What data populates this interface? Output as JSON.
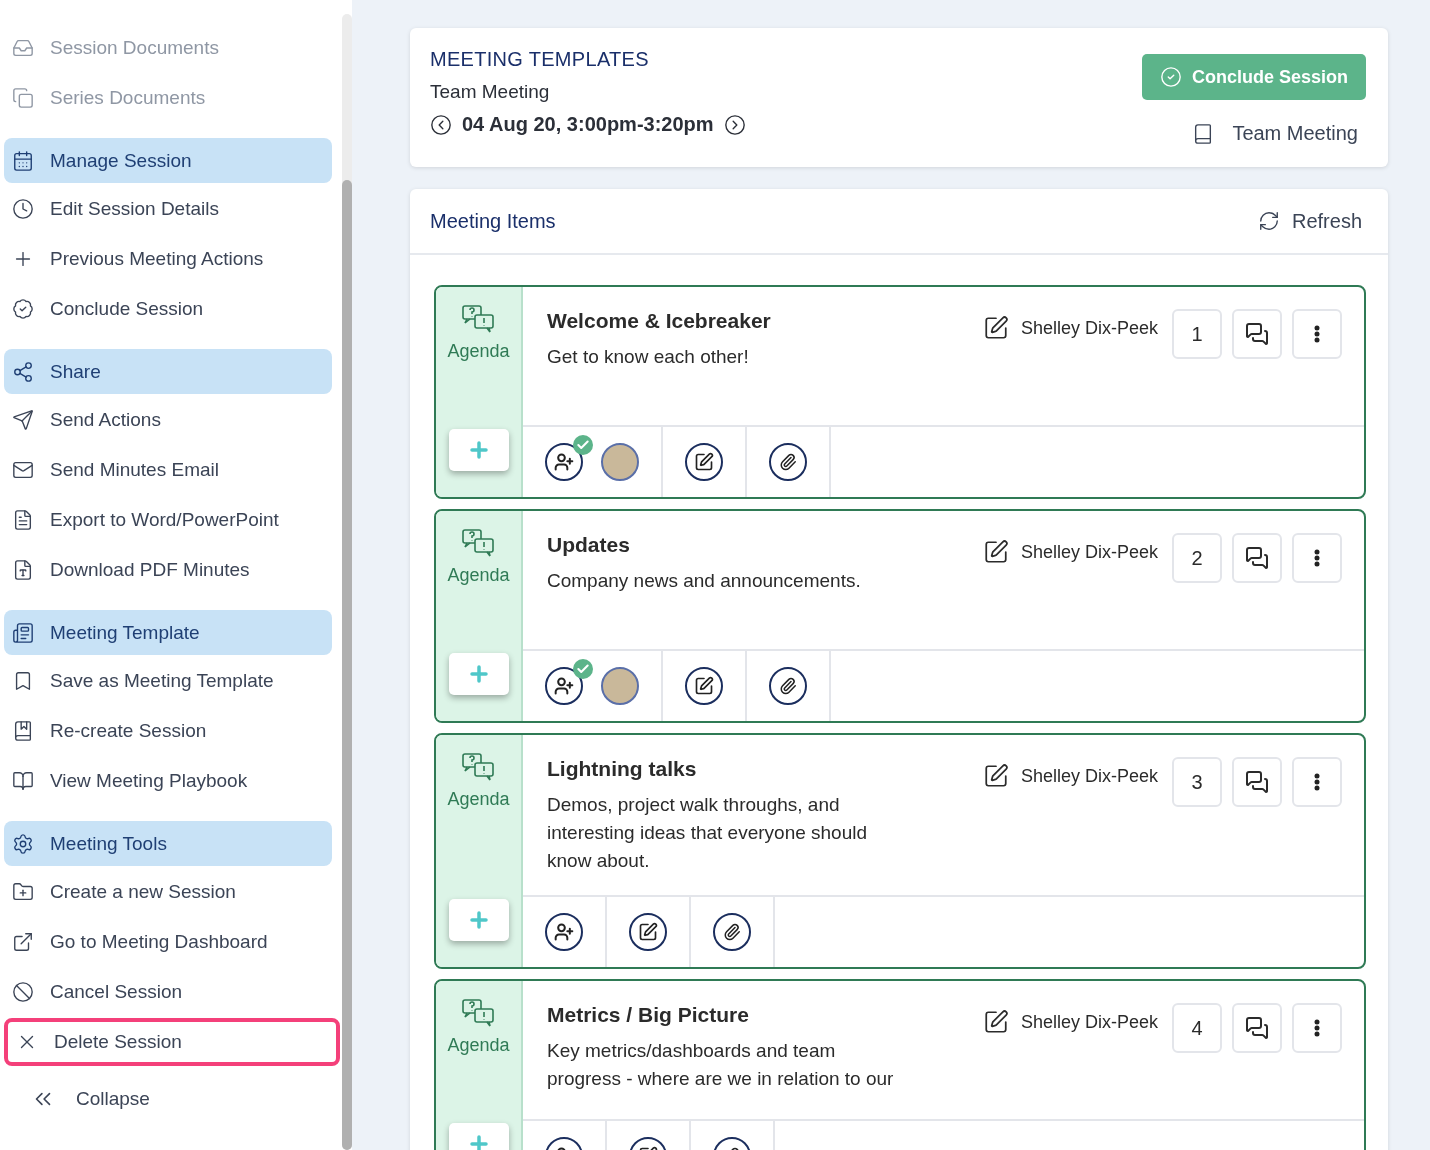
{
  "sidebar": {
    "items": [
      {
        "kind": "item",
        "label": "Session Documents",
        "disabled": true,
        "highlighted": false
      },
      {
        "kind": "item",
        "label": "Series Documents",
        "disabled": true,
        "highlighted": false
      },
      {
        "kind": "section",
        "label": "Manage Session"
      },
      {
        "kind": "item",
        "label": "Edit Session Details",
        "disabled": false,
        "highlighted": false
      },
      {
        "kind": "item",
        "label": "Previous Meeting Actions",
        "disabled": false,
        "highlighted": false
      },
      {
        "kind": "item",
        "label": "Conclude Session",
        "disabled": false,
        "highlighted": false
      },
      {
        "kind": "section",
        "label": "Share"
      },
      {
        "kind": "item",
        "label": "Send Actions",
        "disabled": false,
        "highlighted": false
      },
      {
        "kind": "item",
        "label": "Send Minutes Email",
        "disabled": false,
        "highlighted": false
      },
      {
        "kind": "item",
        "label": "Export to Word/PowerPoint",
        "disabled": false,
        "highlighted": false
      },
      {
        "kind": "item",
        "label": "Download PDF Minutes",
        "disabled": false,
        "highlighted": false
      },
      {
        "kind": "section",
        "label": "Meeting Template"
      },
      {
        "kind": "item",
        "label": "Save as Meeting Template",
        "disabled": false,
        "highlighted": false
      },
      {
        "kind": "item",
        "label": "Re-create Session",
        "disabled": false,
        "highlighted": false
      },
      {
        "kind": "item",
        "label": "View Meeting Playbook",
        "disabled": false,
        "highlighted": false
      },
      {
        "kind": "section",
        "label": "Meeting Tools"
      },
      {
        "kind": "item",
        "label": "Create a new Session",
        "disabled": false,
        "highlighted": false
      },
      {
        "kind": "item",
        "label": "Go to Meeting Dashboard",
        "disabled": false,
        "highlighted": false
      },
      {
        "kind": "item",
        "label": "Cancel Session",
        "disabled": false,
        "highlighted": false
      },
      {
        "kind": "item",
        "label": "Delete Session",
        "disabled": false,
        "highlighted": true
      }
    ],
    "collapse": "Collapse"
  },
  "header": {
    "heading": "MEETING TEMPLATES",
    "meeting_name": "Team Meeting",
    "date_time": "04 Aug 20, 3:00pm-3:20pm",
    "conclude_button": "Conclude Session",
    "template_link": "Team Meeting"
  },
  "meeting_items": {
    "title": "Meeting Items",
    "refresh": "Refresh",
    "items": [
      {
        "type_label": "Agenda",
        "title": "Welcome & Icebreaker",
        "description": "Get to know each other!",
        "owner": "Shelley Dix-Peek",
        "number": "1",
        "attendee_confirmed": true,
        "guest_avatar": true
      },
      {
        "type_label": "Agenda",
        "title": "Updates",
        "description": "Company news and announcements.",
        "owner": "Shelley Dix-Peek",
        "number": "2",
        "attendee_confirmed": true,
        "guest_avatar": true
      },
      {
        "type_label": "Agenda",
        "title": "Lightning talks",
        "description": "Demos, project walk throughs, and interesting ideas that everyone should know about.",
        "owner": "Shelley Dix-Peek",
        "number": "3",
        "attendee_confirmed": false,
        "guest_avatar": false
      },
      {
        "type_label": "Agenda",
        "title": "Metrics / Big Picture",
        "description": "Key metrics/dashboards and team progress - where are we in relation to our",
        "owner": "Shelley Dix-Peek",
        "number": "4"
      }
    ]
  }
}
